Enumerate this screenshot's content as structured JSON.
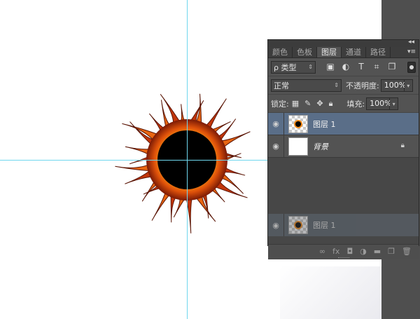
{
  "panel": {
    "tabs": [
      {
        "label": "颜色",
        "active": false
      },
      {
        "label": "色板",
        "active": false
      },
      {
        "label": "图层",
        "active": true
      },
      {
        "label": "通道",
        "active": false
      },
      {
        "label": "路径",
        "active": false
      }
    ],
    "filter": {
      "kind_label": "ρ 类型",
      "icons": [
        "image-filter-icon",
        "adjustment-filter-icon",
        "type-filter-icon",
        "shape-filter-icon",
        "smart-object-filter-icon"
      ]
    },
    "blend": {
      "mode": "正常",
      "opacity_label": "不透明度:",
      "opacity_value": "100%"
    },
    "lock": {
      "label": "锁定:",
      "fill_label": "填充:",
      "fill_value": "100%"
    },
    "layers": [
      {
        "name": "图层 1",
        "selected": true,
        "visible": true
      },
      {
        "name": "背景",
        "selected": false,
        "visible": true,
        "locked": true
      }
    ],
    "drag_ghost": {
      "name": "图层 1"
    }
  },
  "colors": {
    "selection": "#5a6e88",
    "guide": "#6fd7ee",
    "panel_bg": "#535353"
  }
}
